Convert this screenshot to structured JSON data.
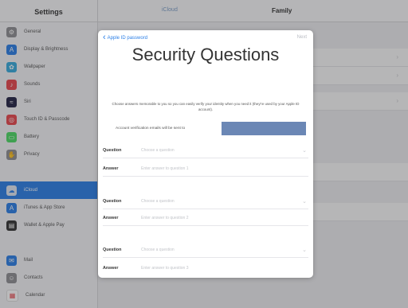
{
  "sidebar": {
    "title": "Settings",
    "items": [
      {
        "label": "General",
        "color": "#8e8e93",
        "icon": "gear-icon"
      },
      {
        "label": "Display & Brightness",
        "color": "#2a7ee6",
        "icon": "brightness-icon"
      },
      {
        "label": "Wallpaper",
        "color": "#35aadc",
        "icon": "wallpaper-icon"
      },
      {
        "label": "Sounds",
        "color": "#e8464c",
        "icon": "speaker-icon"
      },
      {
        "label": "Siri",
        "color": "#222244",
        "icon": "siri-icon"
      },
      {
        "label": "Touch ID & Passcode",
        "color": "#e8464c",
        "icon": "fingerprint-icon"
      },
      {
        "label": "Battery",
        "color": "#4cd964",
        "icon": "battery-icon"
      },
      {
        "label": "Privacy",
        "color": "#8e8e93",
        "icon": "hand-icon"
      },
      {
        "label": "iCloud",
        "color": "#dfe6f2",
        "icon": "cloud-icon"
      },
      {
        "label": "iTunes & App Store",
        "color": "#2a7ee6",
        "icon": "app-store-icon"
      },
      {
        "label": "Wallet & Apple Pay",
        "color": "#333333",
        "icon": "wallet-icon"
      },
      {
        "label": "Mail",
        "color": "#2a7ee6",
        "icon": "mail-icon"
      },
      {
        "label": "Contacts",
        "color": "#8e8e93",
        "icon": "contacts-icon"
      },
      {
        "label": "Calendar",
        "color": "#ffffff",
        "icon": "calendar-icon"
      }
    ]
  },
  "right": {
    "back_label": "iCloud",
    "title": "Family"
  },
  "sheet": {
    "back_label": "Apple ID password",
    "next_label": "Next",
    "title": "Security Questions",
    "intro": "Choose answers memorable to you so you can easily verify your identity when you need it (they're used by your Apple ID account).",
    "rescue_label": "Account verification emails will be sent to",
    "questions": [
      {
        "question_label": "Question",
        "question_placeholder": "Choose a question",
        "answer_label": "Answer",
        "answer_placeholder": "Enter answer to question 1"
      },
      {
        "question_label": "Question",
        "question_placeholder": "Choose a question",
        "answer_label": "Answer",
        "answer_placeholder": "Enter answer to question 2"
      },
      {
        "question_label": "Question",
        "question_placeholder": "Choose a question",
        "answer_label": "Answer",
        "answer_placeholder": "Enter answer to question 3"
      }
    ]
  },
  "colors": {
    "accent": "#2a7ee6",
    "redacted_field": "#6b87b5"
  }
}
